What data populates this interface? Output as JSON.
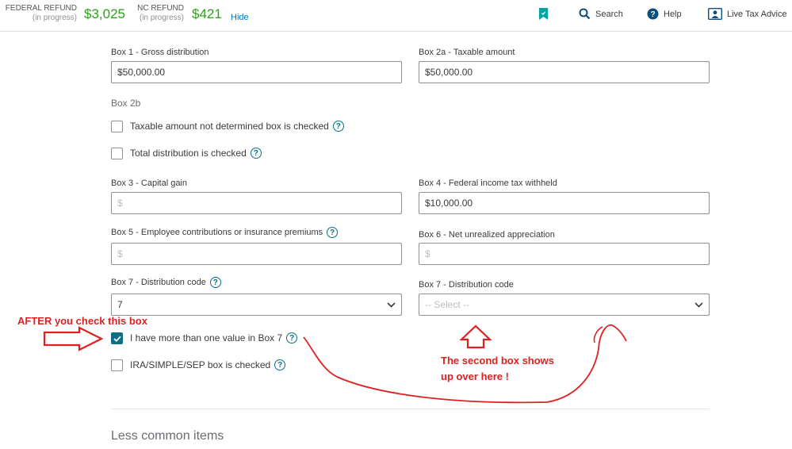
{
  "header": {
    "federal": {
      "label": "FEDERAL REFUND",
      "sub": "(in progress)",
      "amount": "$3,025"
    },
    "state": {
      "label": "NC REFUND",
      "sub": "(in progress)",
      "amount": "$421"
    },
    "hide_label": "Hide",
    "nav": {
      "search": "Search",
      "help": "Help",
      "live": "Live Tax Advice"
    }
  },
  "form": {
    "box1": {
      "label": "Box 1 - Gross distribution",
      "value": "$50,000.00"
    },
    "box2a": {
      "label": "Box 2a - Taxable amount",
      "value": "$50,000.00"
    },
    "box2b": {
      "title": "Box 2b",
      "not_determined": "Taxable amount not determined box is checked",
      "total_distribution": "Total distribution is checked"
    },
    "box3": {
      "label": "Box 3 - Capital gain",
      "placeholder": "$"
    },
    "box4": {
      "label": "Box 4 - Federal income tax withheld",
      "value": "$10,000.00"
    },
    "box5": {
      "label": "Box 5 - Employee contributions or insurance premiums",
      "placeholder": "$"
    },
    "box6": {
      "label": "Box 6 - Net unrealized appreciation",
      "placeholder": "$"
    },
    "box7a": {
      "label": "Box 7 - Distribution code",
      "value": "7"
    },
    "box7b": {
      "label": "Box 7 - Distribution code",
      "value": "-- Select --"
    },
    "more_than_one": {
      "label": "I have more than one value in Box 7",
      "checked": true
    },
    "ira": {
      "label": "IRA/SIMPLE/SEP box is checked",
      "checked": false
    }
  },
  "section": {
    "less_common": "Less common items"
  },
  "annotations": {
    "after_check": "AFTER you check this box",
    "second_box_line1": "The second box shows",
    "second_box_line2": "up over here !"
  },
  "colors": {
    "accent": "#0d6f86",
    "refund_green": "#2ca01c",
    "annotation_red": "#e01f1f",
    "link_blue": "#0077c5"
  }
}
